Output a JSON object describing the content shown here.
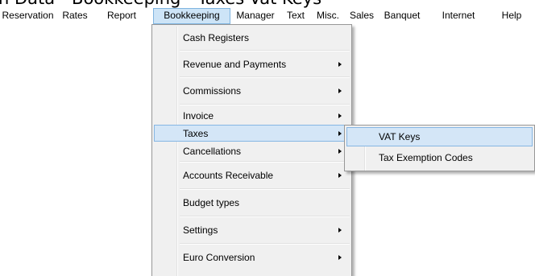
{
  "window": {
    "title": "n Data - Bookkeeping - Taxes-Vat Keys"
  },
  "menubar": {
    "items": [
      {
        "label": "Reservation"
      },
      {
        "label": "Rates"
      },
      {
        "label": "Report"
      },
      {
        "label": "Bookkeeping",
        "active": true
      },
      {
        "label": "Manager"
      },
      {
        "label": "Text"
      },
      {
        "label": "Misc."
      },
      {
        "label": "Sales"
      },
      {
        "label": "Banquet"
      },
      {
        "label": "Internet"
      },
      {
        "label": "Help"
      }
    ]
  },
  "bookkeeping_menu": {
    "items": [
      {
        "label": "Cash Registers",
        "has_submenu": false
      },
      {
        "label": "Revenue and Payments",
        "has_submenu": true
      },
      {
        "label": "Commissions",
        "has_submenu": true
      },
      {
        "label": "Invoice",
        "has_submenu": true
      },
      {
        "label": "Taxes",
        "has_submenu": true,
        "highlighted": true
      },
      {
        "label": "Cancellations",
        "has_submenu": true
      },
      {
        "label": "Accounts Receivable",
        "has_submenu": true
      },
      {
        "label": "Budget types",
        "has_submenu": false
      },
      {
        "label": "Settings",
        "has_submenu": true
      },
      {
        "label": "Euro Conversion",
        "has_submenu": true
      }
    ]
  },
  "taxes_submenu": {
    "items": [
      {
        "label": "VAT Keys",
        "highlighted": true
      },
      {
        "label": "Tax Exemption Codes"
      }
    ]
  },
  "colors": {
    "highlight_fill": "#d4e6f7",
    "highlight_border": "#86b6e3",
    "menu_background": "#f0f0f0",
    "menubar_active": "#cde4f7"
  }
}
